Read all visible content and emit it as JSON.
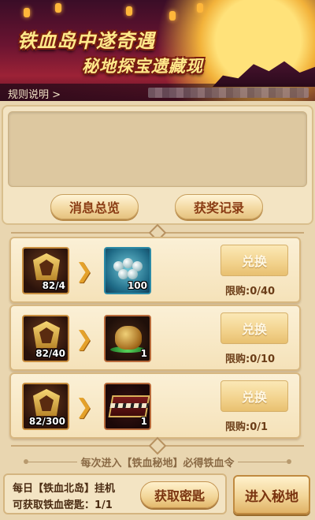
{
  "banner": {
    "title": "铁血岛中遂奇遇",
    "subtitle": "秘地探宝遗藏现",
    "rules_link": "规则说明 >"
  },
  "message_panel": {
    "overview_label": "消息总览",
    "records_label": "获奖记录"
  },
  "exchanges": [
    {
      "cost": "82/4",
      "target_icon": "blue-orbs-box-icon",
      "reward_qty": "100",
      "button": "兑换",
      "limit": "限购:0/40"
    },
    {
      "cost": "82/40",
      "target_icon": "treasure-pot-icon",
      "reward_qty": "1",
      "button": "兑换",
      "limit": "限购:0/10"
    },
    {
      "cost": "82/300",
      "target_icon": "treasure-chest-icon",
      "reward_qty": "1",
      "button": "兑换",
      "limit": "限购:0/1"
    }
  ],
  "notice": "每次进入【铁血秘地】必得铁血令",
  "daily": {
    "line1": "每日【铁血北岛】挂机",
    "line2": "可获取铁血密匙：1/1",
    "claim_button": "获取密匙"
  },
  "enter_button": "进入秘地",
  "colors": {
    "accent_text": "#8a3c14",
    "panel_bg": "#f3e4c3",
    "page_bg": "#e9d6b0"
  }
}
